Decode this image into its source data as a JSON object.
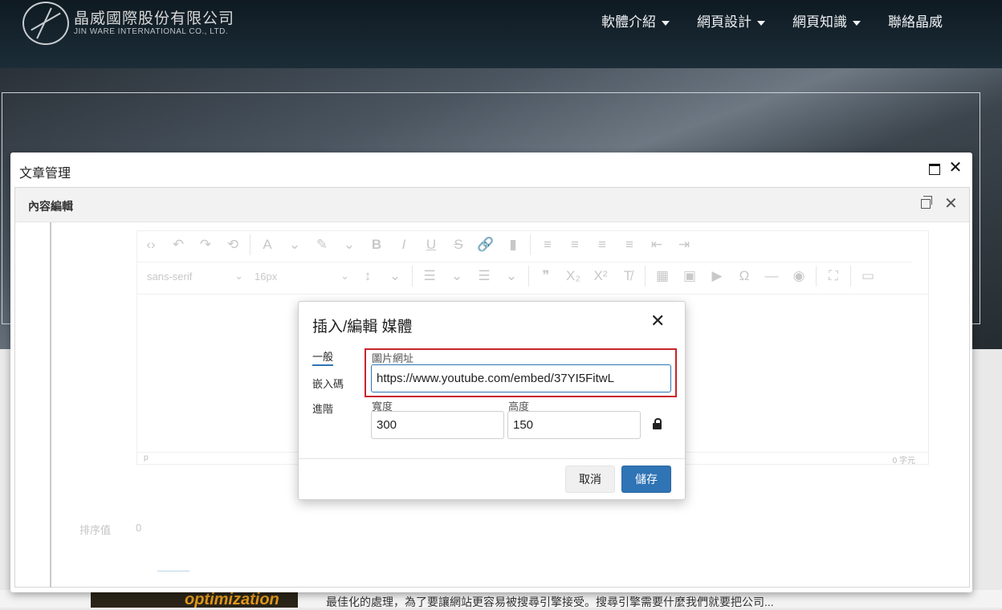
{
  "site": {
    "brand": "晶威國際股份有限公司",
    "brand_en": "JIN WARE INTERNATIONAL CO., LTD.",
    "nav": [
      "軟體介紹",
      "網頁設計",
      "網頁知識",
      "聯絡晶威"
    ],
    "article_snippet": "最佳化的處理，為了要讓網站更容易被搜尋引擎接受。搜尋引擎需要什麼我們就要把公司...",
    "thumb_text": "optimization"
  },
  "window": {
    "title": "文章管理",
    "panel_title": "內容編輯"
  },
  "editor": {
    "font_family": "sans-serif",
    "font_size": "16px",
    "status_path": "p",
    "word_count": "0 字元"
  },
  "form": {
    "sort_label": "排序值",
    "sort_value": "0"
  },
  "media_dialog": {
    "title": "插入/編輯 媒體",
    "tabs": [
      "一般",
      "嵌入碼",
      "進階"
    ],
    "active_tab": "一般",
    "url_label": "圖片網址",
    "url_value": "https://www.youtube.com/embed/37YI5FitwL",
    "width_label": "寬度",
    "width_value": "300",
    "height_label": "高度",
    "height_value": "150",
    "cancel_label": "取消",
    "save_label": "儲存",
    "highlight_color": "#c8232b",
    "primary_color": "#2f74b5"
  }
}
